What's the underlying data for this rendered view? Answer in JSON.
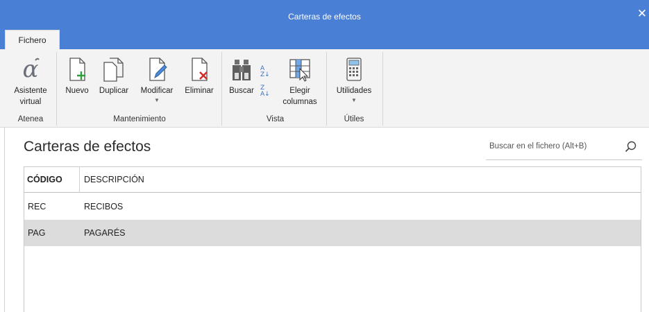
{
  "window": {
    "title": "Carteras de efectos",
    "close_glyph": "✕"
  },
  "tabs": [
    {
      "label": "Fichero"
    }
  ],
  "ribbon": {
    "groups": [
      {
        "label": "Atenea",
        "buttons": [
          {
            "line1": "Asistente",
            "line2": "virtual",
            "icon": "alpha-assistant-icon"
          }
        ]
      },
      {
        "label": "Mantenimiento",
        "buttons": [
          {
            "line1": "Nuevo",
            "icon": "new-document-icon"
          },
          {
            "line1": "Duplicar",
            "icon": "duplicate-icon"
          },
          {
            "line1": "Modificar",
            "icon": "edit-document-icon",
            "has_dropdown": true
          },
          {
            "line1": "Eliminar",
            "icon": "delete-document-icon"
          }
        ]
      },
      {
        "label": "Vista",
        "buttons": [
          {
            "line1": "Buscar",
            "icon": "binoculars-icon"
          },
          {
            "line1": "Elegir",
            "line2": "columnas",
            "icon": "choose-columns-icon"
          }
        ]
      },
      {
        "label": "Útiles",
        "buttons": [
          {
            "line1": "Utilidades",
            "icon": "calculator-icon",
            "has_dropdown": true
          }
        ]
      }
    ]
  },
  "main": {
    "title": "Carteras de efectos",
    "search": {
      "placeholder": "Buscar en el fichero (Alt+B)"
    },
    "table": {
      "columns": [
        "CÓDIGO",
        "DESCRIPCIÓN"
      ],
      "rows": [
        {
          "code": "REC",
          "description": "RECIBOS",
          "selected": false
        },
        {
          "code": "PAG",
          "description": "PAGARÉS",
          "selected": true
        }
      ]
    }
  },
  "colors": {
    "accent": "#4a7fd6",
    "ribbon_bg": "#f3f3f3",
    "selected_row": "#dcdcdc"
  }
}
